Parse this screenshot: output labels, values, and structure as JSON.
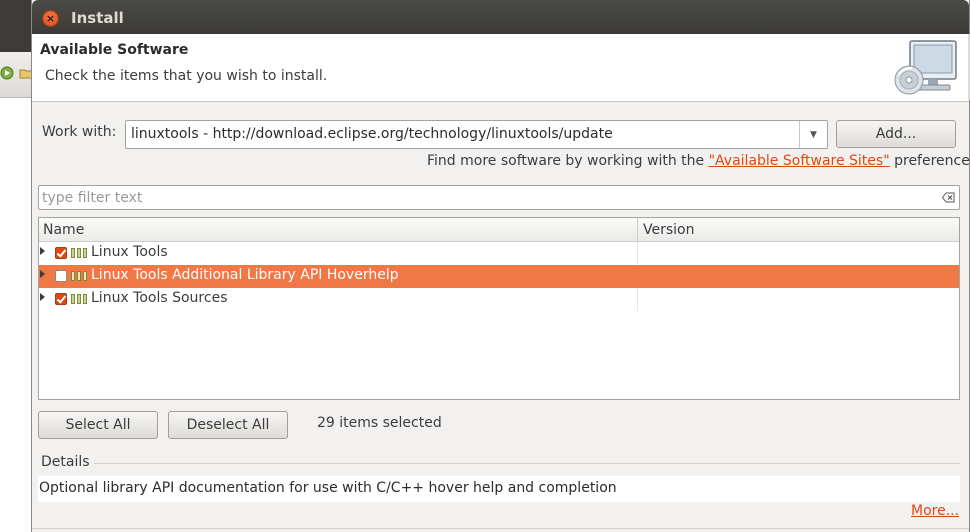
{
  "window": {
    "title": "Install",
    "close_symbol": "×"
  },
  "header": {
    "title": "Available Software",
    "description": "Check the items that you wish to install.",
    "image_icon": "install-wizard-icon"
  },
  "work_with": {
    "label": "Work with:",
    "value": "linuxtools - http://download.eclipse.org/technology/linuxtools/update",
    "dropdown_arrow": "▼",
    "add_button": "Add..."
  },
  "more_sites": {
    "prefix": "Find more software by working with the ",
    "link": "\"Available Software Sites\"",
    "suffix": " preferences."
  },
  "filter": {
    "placeholder": "type filter text",
    "value": ""
  },
  "table": {
    "columns": [
      "Name",
      "Version"
    ],
    "rows": [
      {
        "label": "Linux Tools",
        "checked": true,
        "selected": false,
        "version": ""
      },
      {
        "label": "Linux Tools Additional Library API Hoverhelp",
        "checked": false,
        "selected": true,
        "version": ""
      },
      {
        "label": "Linux Tools Sources",
        "checked": true,
        "selected": false,
        "version": ""
      }
    ]
  },
  "actions": {
    "select_all": "Select All",
    "deselect_all": "Deselect All",
    "selected_count": "29 items selected"
  },
  "details": {
    "label": "Details",
    "text": "Optional library API documentation for use with C/C++ hover help and completion",
    "more_link": "More..."
  },
  "colors": {
    "accent": "#dd4814",
    "selection": "#f07746",
    "titlebar": "#3c3b37"
  }
}
